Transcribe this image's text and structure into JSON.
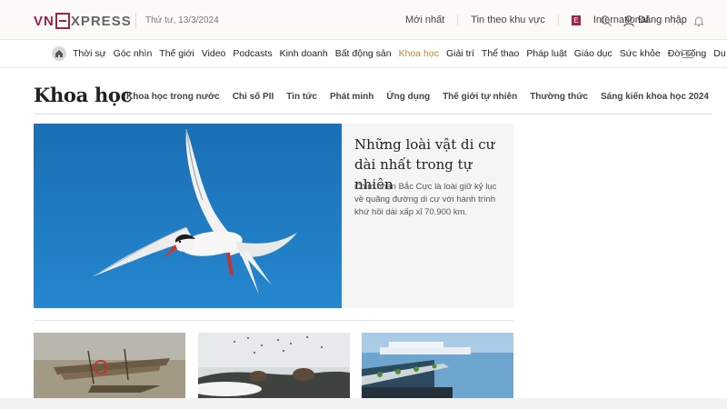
{
  "header": {
    "logo": {
      "part1": "VN",
      "part2": "XPRESS"
    },
    "date": "Thứ tư, 13/3/2024",
    "latest": "Mới nhất",
    "by_area": "Tin theo khu vực",
    "international": "International",
    "intl_badge": "E",
    "login": "Đăng nhập"
  },
  "nav": {
    "items": [
      "Thời sự",
      "Góc nhìn",
      "Thế giới",
      "Video",
      "Podcasts",
      "Kinh doanh",
      "Bất động sản",
      "Khoa học",
      "Giải trí",
      "Thể thao",
      "Pháp luật",
      "Giáo dục",
      "Sức khỏe",
      "Đời sống",
      "Du lịch"
    ],
    "active": "Khoa học"
  },
  "section": {
    "title": "Khoa học",
    "subnav": [
      "Khoa học trong nước",
      "Chỉ số PII",
      "Tin tức",
      "Phát minh",
      "Ứng dụng",
      "Thế giới tự nhiên",
      "Thường thức",
      "Sáng kiến khoa học 2024"
    ]
  },
  "featured": {
    "title": "Những loài vật di cư dài nhất trong tự nhiên",
    "description": "Chim nhạn Bắc Cực là loài giữ kỷ lục về quãng đường di cư với hành trình khứ hồi dài xấp xỉ 70.900 km."
  },
  "colors": {
    "brand": "#9f224e",
    "active_nav": "#c0862e",
    "sky": "#1c78bf"
  }
}
